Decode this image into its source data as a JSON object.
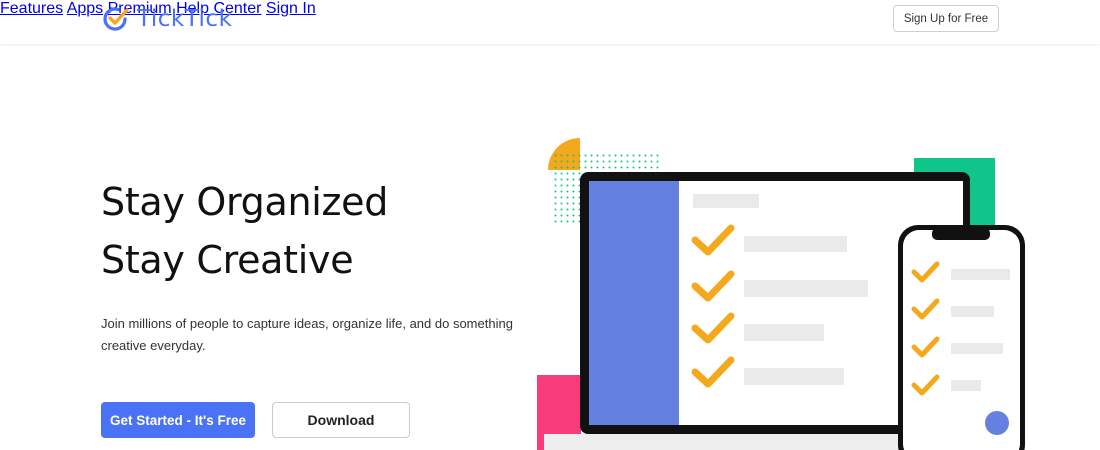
{
  "brand": {
    "name": "TickTick",
    "color": "#4772fa"
  },
  "nav": {
    "items": [
      "Features",
      "Apps",
      "Premium",
      "Help Center",
      "Sign In"
    ],
    "signup_label": "Sign Up for Free"
  },
  "hero": {
    "title_line1": "Stay Organized",
    "title_line2": "Stay Creative",
    "description": "Join millions of people to capture ideas, organize life, and do something creative everyday.",
    "primary_button": "Get Started - It's Free",
    "secondary_button": "Download"
  },
  "colors": {
    "primary": "#4a72f5",
    "sidebar_blue": "#6581e0",
    "check_orange": "#f5a81c",
    "green_accent": "#10c58a",
    "pink_accent": "#f73c7c",
    "placeholder_gray": "#eaeaea"
  }
}
